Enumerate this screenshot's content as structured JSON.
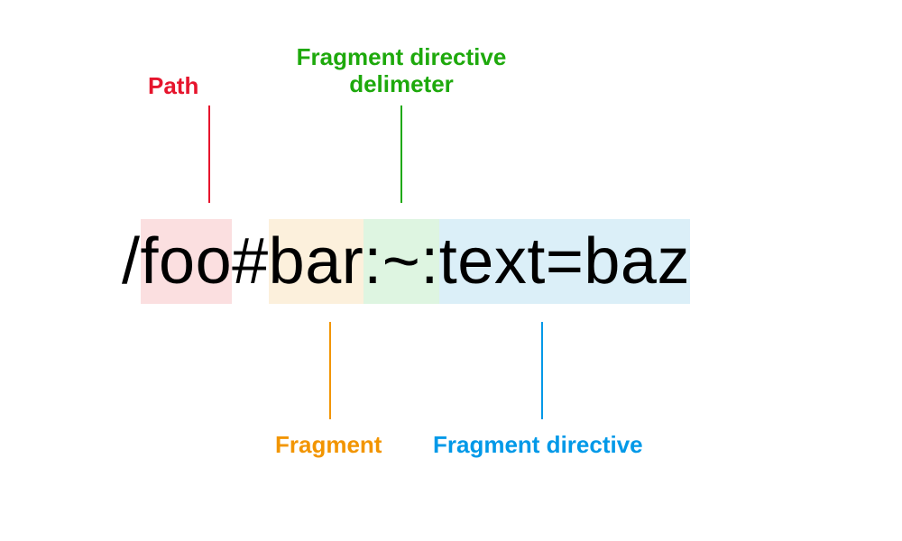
{
  "labels": {
    "path": "Path",
    "delimiter_line1": "Fragment directive",
    "delimiter_line2": "delimeter",
    "fragment": "Fragment",
    "directive": "Fragment directive"
  },
  "url": {
    "slash": "/",
    "path": "foo",
    "hash": "#",
    "fragment": "bar",
    "delimiter": ":~:",
    "directive": "text=baz"
  },
  "colors": {
    "path": "#e6152d",
    "delimiter": "#1ea90c",
    "fragment": "#f29500",
    "directive": "#0099e8",
    "hi_path": "#fbdfe0",
    "hi_frag": "#fcf0dc",
    "hi_delim": "#def5e1",
    "hi_dir": "#dbeff8"
  }
}
